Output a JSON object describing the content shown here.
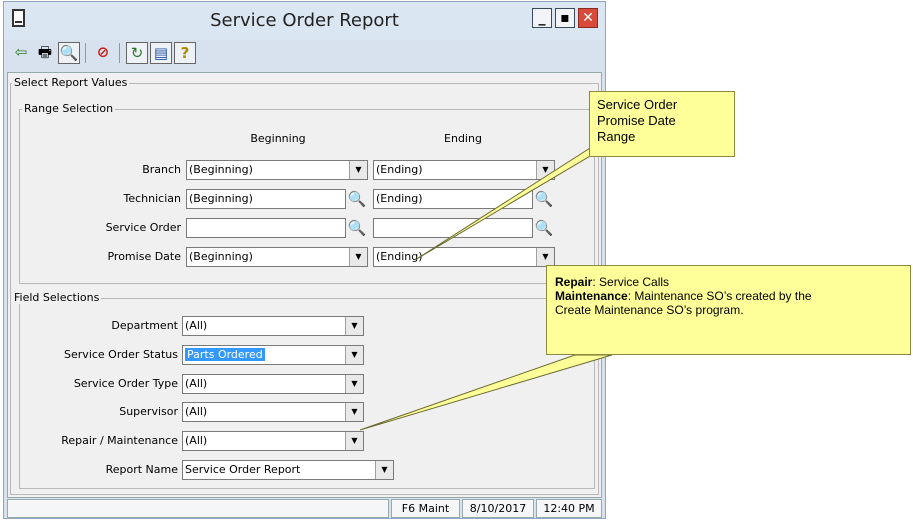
{
  "window": {
    "title": "Service Order Report"
  },
  "toolbar": {
    "buttons": [
      "exit-icon",
      "print-icon",
      "print-preview-icon",
      "cancel-icon",
      "refresh-icon",
      "help-book-icon",
      "help-icon"
    ]
  },
  "report_values": {
    "legend": "Select Report Values",
    "range": {
      "legend": "Range Selection",
      "col_beginning": "Beginning",
      "col_ending": "Ending",
      "branch": {
        "label": "Branch",
        "begin": "(Beginning)",
        "end": "(Ending)"
      },
      "technician": {
        "label": "Technician",
        "begin": "(Beginning)",
        "end": "(Ending)"
      },
      "service_order": {
        "label": "Service Order",
        "begin": "",
        "end": ""
      },
      "promise_date": {
        "label": "Promise Date",
        "begin": "(Beginning)",
        "end": "(Ending)"
      }
    },
    "fields": {
      "legend": "Field Selections",
      "department": {
        "label": "Department",
        "value": "(All)"
      },
      "so_status": {
        "label": "Service Order Status",
        "value": "Parts Ordered"
      },
      "so_type": {
        "label": "Service Order Type",
        "value": "(All)"
      },
      "supervisor": {
        "label": "Supervisor",
        "value": "(All)"
      },
      "repair_maintenance": {
        "label": "Repair / Maintenance",
        "value": "(All)"
      },
      "report_name": {
        "label": "Report Name",
        "value": "Service Order Report"
      }
    }
  },
  "statusbar": {
    "mode": "F6 Maint",
    "date": "8/10/2017",
    "time": "12:40 PM"
  },
  "callouts": {
    "promise": {
      "line1": "Service Order",
      "line2": "Promise Date",
      "line3": "Range"
    },
    "repair": {
      "repair_bold": "Repair",
      "repair_text": ":  Service Calls",
      "maint_bold": "Maintenance",
      "maint_text": ": Maintenance SO’s created by the",
      "line3": "Create Maintenance SO’s program."
    }
  },
  "colors": {
    "callout_bg": "#ffff99",
    "selected_bg": "#3399ff",
    "close_btn": "#d84a3a"
  }
}
